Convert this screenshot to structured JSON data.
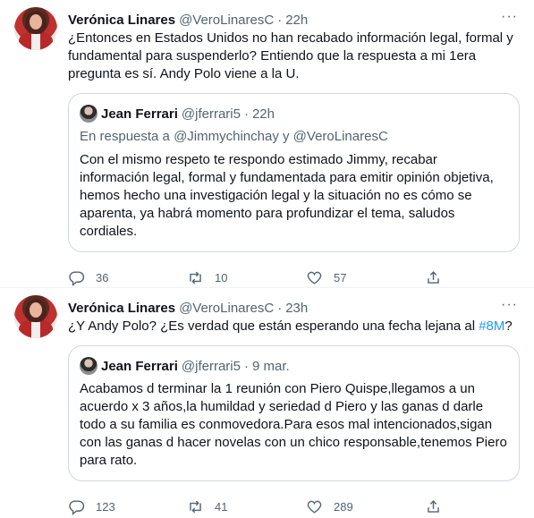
{
  "tweets": [
    {
      "author": {
        "name": "Verónica Linares",
        "handle": "@VeroLinaresC",
        "time": "22h"
      },
      "text": "¿Entonces en Estados Unidos no han recabado información legal, formal y fundamental para suspenderlo? Entiendo que la respuesta a mi 1era pregunta es sí. Andy Polo viene a la U.",
      "quote": {
        "name": "Jean Ferrari",
        "handle": "@jferrari5",
        "time": "22h",
        "reply_prefix": "En respuesta a",
        "reply_to": "@Jimmychinchay y @VeroLinaresC",
        "text": "Con el mismo respeto te respondo estimado Jimmy, recabar información legal, formal y fundamentada para emitir opinión objetiva, hemos hecho una investigación legal y la situación no es cómo se aparenta, ya habrá momento para profundizar el tema, saludos cordiales."
      },
      "stats": {
        "replies": "36",
        "retweets": "10",
        "likes": "57"
      }
    },
    {
      "author": {
        "name": "Verónica Linares",
        "handle": "@VeroLinaresC",
        "time": "23h"
      },
      "text_before": "¿Y Andy Polo? ¿Es verdad que están esperando una fecha lejana al ",
      "hashtag": "#8M",
      "text_after": "?",
      "quote": {
        "name": "Jean Ferrari",
        "handle": "@jferrari5",
        "time": "9 mar.",
        "text": "Acabamos d terminar la 1 reunión con Piero Quispe,llegamos a un acuerdo x 3 años,la humildad y seriedad d Piero y las ganas d darle todo a su familia es conmovedora.Para esos mal intencionados,sigan con las ganas d hacer novelas con un chico responsable,tenemos Piero para rato."
      },
      "stats": {
        "replies": "123",
        "retweets": "41",
        "likes": "289"
      }
    }
  ],
  "ui": {
    "dot": "·",
    "more": "···"
  },
  "icons": [
    "more-icon",
    "reply-icon",
    "retweet-icon",
    "like-icon",
    "share-icon"
  ]
}
